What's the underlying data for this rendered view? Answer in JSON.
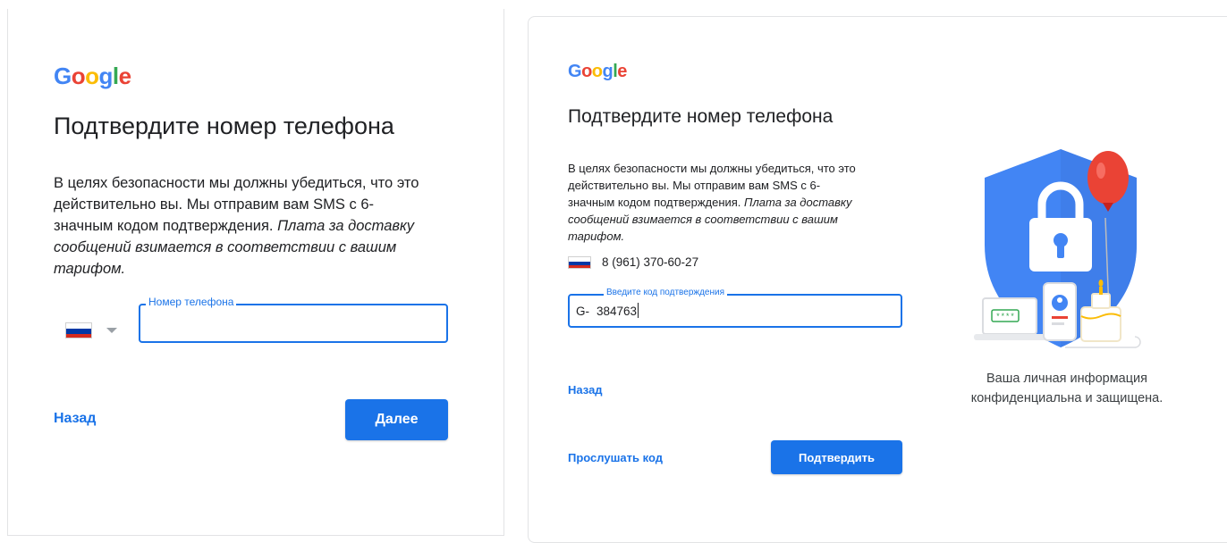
{
  "left": {
    "logo": [
      "G",
      "o",
      "o",
      "g",
      "l",
      "e"
    ],
    "title": "Подтвердите номер телефона",
    "description_lines": [
      "В целях безопасности мы должны убедиться, что это",
      "действительно вы. Мы отправим вам SMS с 6-",
      "значным кодом подтверждения."
    ],
    "description_italic_first": "Плата за доставку",
    "description_italic_lines": [
      "сообщений взимается в соответствии с вашим",
      "тарифом."
    ],
    "phone_field_label": "Номер телефона",
    "phone_value": "",
    "back_link": "Назад",
    "next_button": "Далее"
  },
  "right": {
    "logo": [
      "G",
      "o",
      "o",
      "g",
      "l",
      "e"
    ],
    "title": "Подтвердите номер телефона",
    "description_lines": [
      "В целях безопасности мы должны убедиться, что это",
      "действительно вы. Мы отправим вам SMS с 6-",
      "значным кодом подтверждения."
    ],
    "description_italic_first": "Плата за доставку",
    "description_italic_lines": [
      "сообщений взимается в соответствии с вашим",
      "тарифом."
    ],
    "phone_number": "8 (961) 370-60-27",
    "code_field_label": "Введите код подтверждения",
    "code_prefix": "G-",
    "code_value": "384763",
    "back_link": "Назад",
    "listen_link": "Прослушать код",
    "confirm_button": "Подтвердить",
    "privacy_text_line1": "Ваша личная информация",
    "privacy_text_line2": "конфиденциальна и защищена.",
    "illustration_code": "****"
  },
  "colors": {
    "google_blue": "#4285F4",
    "google_red": "#EA4335",
    "google_yellow": "#FBBC05",
    "google_green": "#34A853",
    "accent": "#1a73e8",
    "shield": "#4285F4",
    "balloon": "#EA4335"
  },
  "icons": {
    "country_flag": "russia-flag-icon",
    "dropdown": "triangle-down-icon",
    "illustration": "security-shield-lock-icon"
  }
}
